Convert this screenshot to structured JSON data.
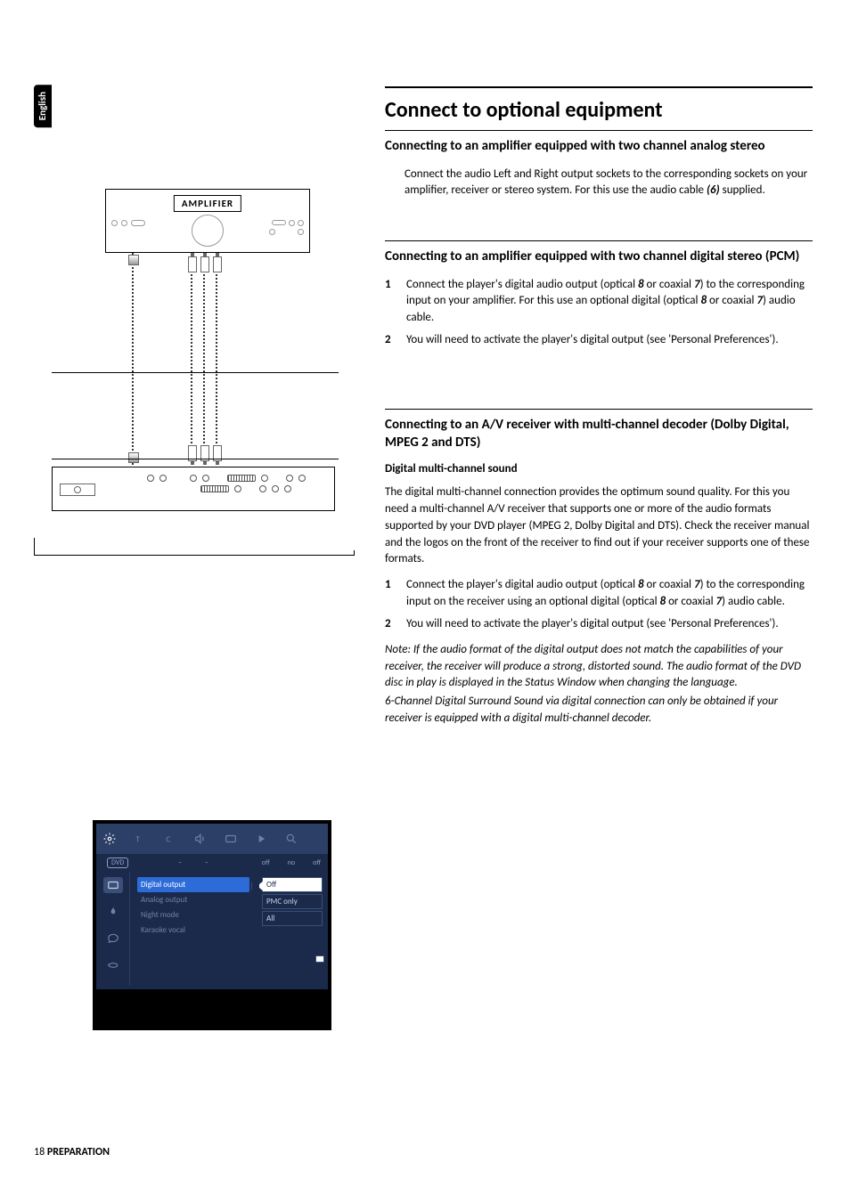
{
  "side_tab": "English",
  "title": "Connect to optional equipment",
  "section1": {
    "heading": "Connecting to an amplifier equipped with two channel analog stereo",
    "body_a": "Connect the audio Left and Right output sockets to the corresponding sockets on your amplifier, receiver or stereo system. For this use the audio cable ",
    "body_b": "(6)",
    "body_c": " supplied."
  },
  "section2": {
    "heading": "Connecting to an amplifier equipped with two channel digital stereo (PCM)",
    "step1_a": "Connect the player's digital audio output (optical ",
    "step1_b": "8",
    "step1_c": " or coaxial ",
    "step1_d": "7",
    "step1_e": ") to the corresponding input on your amplifier. For this use an optional digital (optical ",
    "step1_f": "8",
    "step1_g": " or coaxial ",
    "step1_h": "7",
    "step1_i": ") audio cable.",
    "step2": "You will need to activate the player's digital output (see 'Personal Preferences')."
  },
  "section3": {
    "heading": "Connecting to an A/V receiver with multi-channel decoder (Dolby Digital, MPEG 2 and DTS)",
    "subheading": "Digital multi-channel sound",
    "body": "The digital multi-channel connection provides the optimum sound quality. For this you need a multi-channel A/V receiver that supports one or more of the audio formats supported by your DVD player (MPEG 2, Dolby Digital and DTS). Check the receiver manual and the logos on the front of the receiver to find out if your receiver supports one of these formats.",
    "step1_a": "Connect the player's digital audio output (optical ",
    "step1_b": "8",
    "step1_c": " or coaxial ",
    "step1_d": "7",
    "step1_e": ") to the corresponding input on the receiver using an optional digital (optical ",
    "step1_f": "8",
    "step1_g": " or coaxial ",
    "step1_h": "7",
    "step1_i": ") audio cable.",
    "step2": "You will need to activate the player's digital output (see 'Personal Preferences').",
    "note1": "Note:  If the audio format of the digital output does not match the capabilities of your receiver, the receiver will produce a strong, distorted sound. The audio format of the DVD disc in play is displayed in the Status Window when changing the language.",
    "note2": "6-Channel Digital Surround Sound via digital connection can only be obtained if your receiver is equipped with a digital multi-channel decoder."
  },
  "diagram1": {
    "amp_label": "AMPLIFIER"
  },
  "diagram2": {
    "disc_label": "DVD",
    "top_vals": [
      "off",
      "no",
      "off"
    ],
    "menu": [
      "Digital output",
      "Analog output",
      "Night mode",
      "Karaoke vocal"
    ],
    "options": [
      "Off",
      "PMC only",
      "All"
    ]
  },
  "footer": {
    "page": "18",
    "section": "PREPARATION"
  }
}
